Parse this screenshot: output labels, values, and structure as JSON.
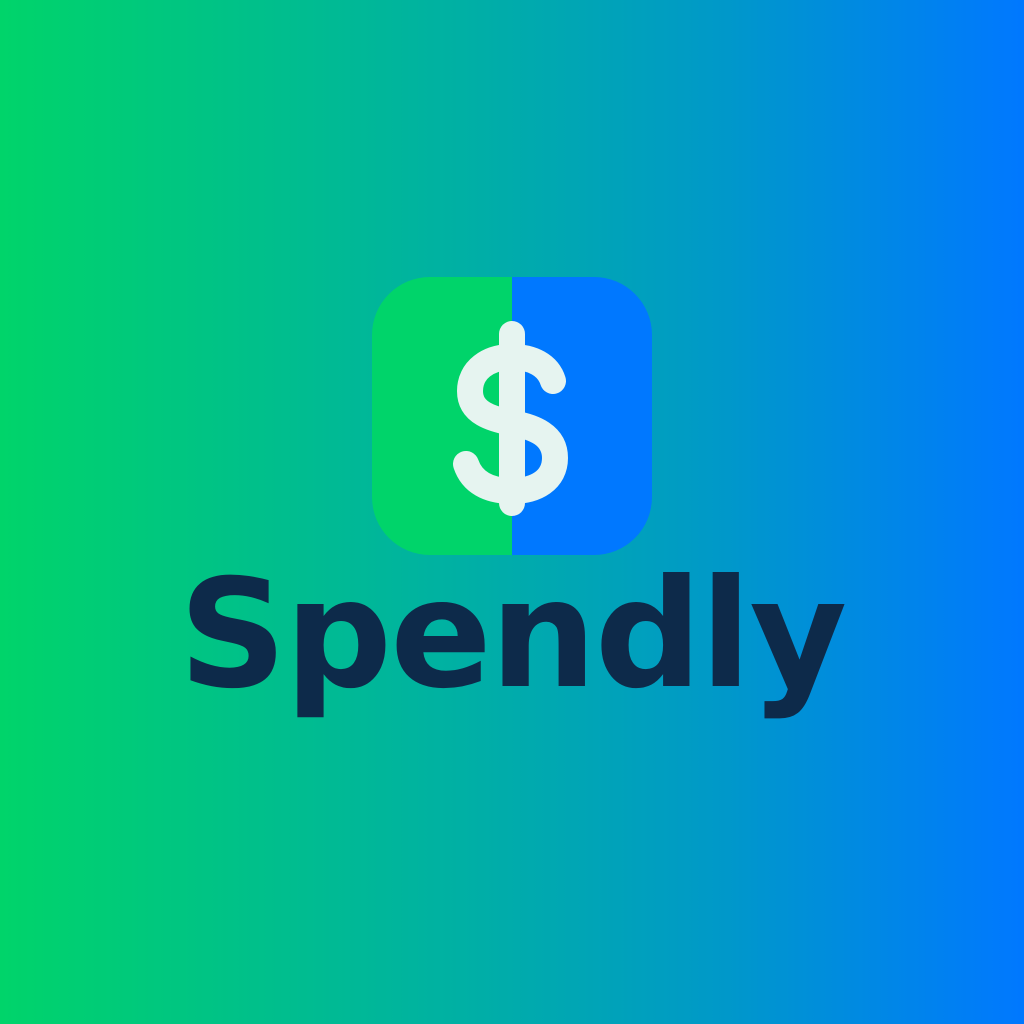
{
  "brand": {
    "name": "Spendly",
    "icon": "dollar-sign-icon"
  },
  "colors": {
    "background_start": "#00d46a",
    "background_end": "#0078ff",
    "icon_left": "#00d46a",
    "icon_right": "#0078ff",
    "symbol": "#e6f4f0",
    "wordmark": "#0d2a4a"
  }
}
